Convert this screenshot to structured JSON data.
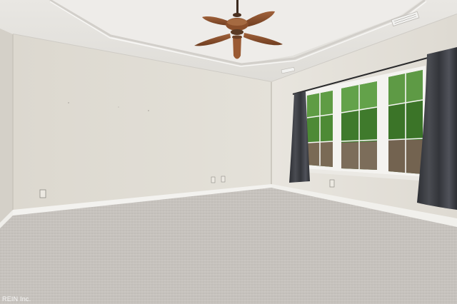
{
  "photo": {
    "subject": "empty-bedroom",
    "watermark": "REIN Inc."
  },
  "colors": {
    "wall": "#e2ded5",
    "ceiling": "#eceae6",
    "carpet": "#c9c6c1",
    "curtain": "#3a3c42",
    "trim": "#f2f1ee",
    "fan_wood": "#8a4f2b",
    "foliage": "#3f7a2c"
  }
}
